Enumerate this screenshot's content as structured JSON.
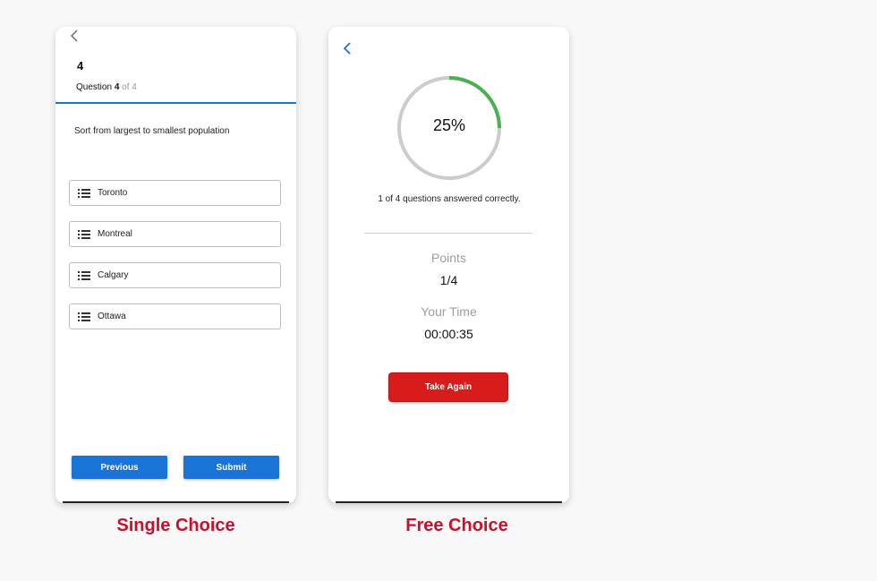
{
  "colors": {
    "primary": "#1a73d6",
    "danger": "#d81c1c",
    "progress": "#4caf50",
    "caption": "#c8102e"
  },
  "single_choice": {
    "question_number": "4",
    "progress_prefix": "Question ",
    "progress_current": "4",
    "progress_suffix": " of 4",
    "prompt": "Sort from largest to smallest population",
    "options": [
      {
        "label": "Toronto",
        "icon": "drag-list-icon"
      },
      {
        "label": "Montreal",
        "icon": "drag-list-icon"
      },
      {
        "label": "Calgary",
        "icon": "drag-list-icon"
      },
      {
        "label": "Ottawa",
        "icon": "drag-list-icon"
      }
    ],
    "previous_label": "Previous",
    "submit_label": "Submit",
    "caption": "Single Choice"
  },
  "free_choice": {
    "score_fraction": 0.25,
    "score_percent": "25%",
    "summary": "1 of 4 questions answered correctly.",
    "points_label": "Points",
    "points_value": "1/4",
    "time_label": "Your Time",
    "time_value": "00:00:35",
    "take_again_label": "Take Again",
    "caption": "Free Choice"
  }
}
